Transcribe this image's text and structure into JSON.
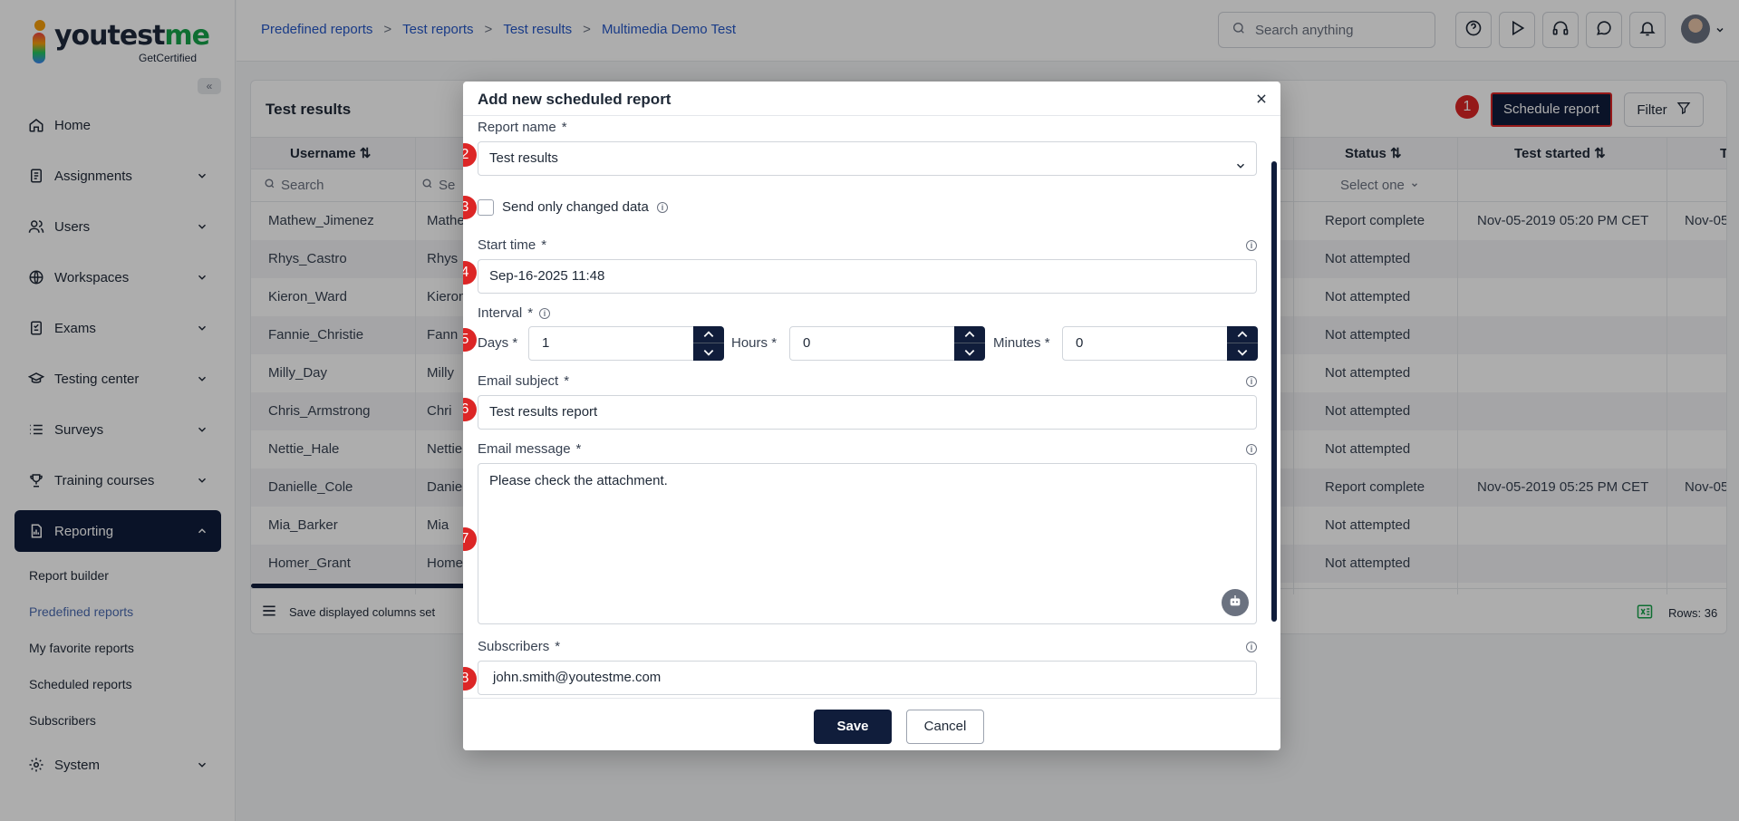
{
  "brand": {
    "logo_prefix": "youtest",
    "logo_accent": "me",
    "tagline": "GetCertified"
  },
  "sidebar": {
    "collapse_label": "«",
    "items": [
      {
        "label": "Home"
      },
      {
        "label": "Assignments"
      },
      {
        "label": "Users"
      },
      {
        "label": "Workspaces"
      },
      {
        "label": "Exams"
      },
      {
        "label": "Testing center"
      },
      {
        "label": "Surveys"
      },
      {
        "label": "Training courses"
      },
      {
        "label": "Reporting"
      },
      {
        "label": "System"
      }
    ],
    "reporting_sub": [
      {
        "label": "Report builder"
      },
      {
        "label": "Predefined reports"
      },
      {
        "label": "My favorite reports"
      },
      {
        "label": "Scheduled reports"
      },
      {
        "label": "Subscribers"
      }
    ]
  },
  "header": {
    "breadcrumb": [
      "Predefined reports",
      "Test reports",
      "Test results",
      "Multimedia Demo Test"
    ],
    "breadcrumb_sep": ">",
    "search_placeholder": "Search anything"
  },
  "card": {
    "title": "Test results",
    "schedule_label": "Schedule report",
    "filter_label": "Filter",
    "columns": {
      "username": "Username",
      "status": "Status",
      "test_started": "Test started",
      "next": "T"
    },
    "filter_placeholder": "Search",
    "filter_placeholder_2": "Se",
    "status_filter": "Select one",
    "rows": [
      {
        "username": "Mathew_Jimenez",
        "first": "Mathe",
        "status": "Report complete",
        "started": "Nov-05-2019 05:20 PM CET",
        "next": "Nov-05"
      },
      {
        "username": "Rhys_Castro",
        "first": "Rhys",
        "status": "Not attempted",
        "started": "",
        "next": ""
      },
      {
        "username": "Kieron_Ward",
        "first": "Kieron",
        "status": "Not attempted",
        "started": "",
        "next": ""
      },
      {
        "username": "Fannie_Christie",
        "first": "Fann",
        "status": "Not attempted",
        "started": "",
        "next": ""
      },
      {
        "username": "Milly_Day",
        "first": "Milly",
        "status": "Not attempted",
        "started": "",
        "next": ""
      },
      {
        "username": "Chris_Armstrong",
        "first": "Chri",
        "status": "Not attempted",
        "started": "",
        "next": ""
      },
      {
        "username": "Nettie_Hale",
        "first": "Nettie",
        "status": "Not attempted",
        "started": "",
        "next": ""
      },
      {
        "username": "Danielle_Cole",
        "first": "Daniel",
        "status": "Report complete",
        "started": "Nov-05-2019 05:25 PM CET",
        "next": "Nov-05"
      },
      {
        "username": "Mia_Barker",
        "first": "Mia",
        "status": "Not attempted",
        "started": "",
        "next": ""
      },
      {
        "username": "Homer_Grant",
        "first": "Home",
        "status": "Not attempted",
        "started": "",
        "next": ""
      }
    ],
    "save_columns_label": "Save displayed columns set",
    "rows_count": "Rows: 36"
  },
  "modal": {
    "title": "Add new scheduled report",
    "report_name_label": "Report name",
    "report_name_value": "Test results",
    "send_changed_label": "Send only changed data",
    "start_time_label": "Start time",
    "start_time_value": "Sep-16-2025 11:48",
    "interval_label": "Interval",
    "days_label": "Days",
    "days_value": "1",
    "hours_label": "Hours",
    "hours_value": "0",
    "minutes_label": "Minutes",
    "minutes_value": "0",
    "email_subject_label": "Email subject",
    "email_subject_value": "Test results report",
    "email_message_label": "Email message",
    "email_message_value": "Please check the attachment.",
    "subscribers_label": "Subscribers",
    "subscribers_value": "john.smith@youtestme.com",
    "required_mark": "*",
    "save_label": "Save",
    "cancel_label": "Cancel"
  },
  "steps": [
    "1",
    "2",
    "3",
    "4",
    "5",
    "6",
    "7",
    "8"
  ],
  "colors": {
    "navy": "#101d3b",
    "accent_link": "#2557c7",
    "step_red": "#dc2626"
  }
}
